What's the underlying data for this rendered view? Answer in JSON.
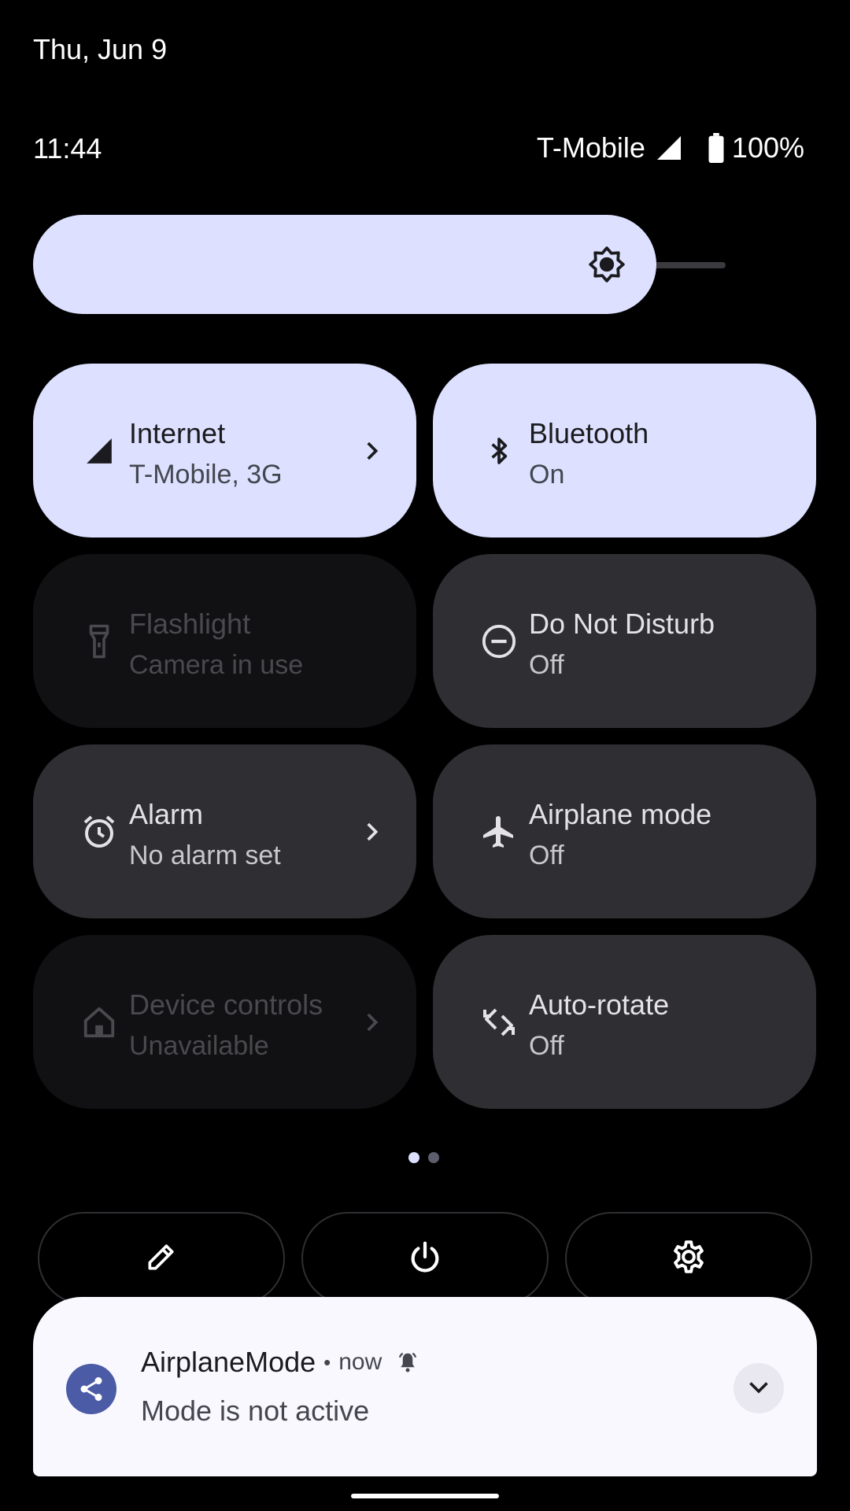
{
  "status": {
    "date": "Thu, Jun 9",
    "time": "11:44",
    "carrier": "T-Mobile",
    "battery": "100%",
    "signal_icon": "signal-full-icon",
    "battery_icon": "battery-full-icon"
  },
  "brightness": {
    "level": 0.86,
    "icon": "brightness-icon"
  },
  "tiles": [
    {
      "label": "Internet",
      "sub": "T-Mobile, 3G",
      "state": "active",
      "icon": "signal-icon",
      "chevron": true
    },
    {
      "label": "Bluetooth",
      "sub": "On",
      "state": "active",
      "icon": "bluetooth-icon",
      "chevron": false
    },
    {
      "label": "Flashlight",
      "sub": "Camera in use",
      "state": "unavailable",
      "icon": "flashlight-icon",
      "chevron": false
    },
    {
      "label": "Do Not Disturb",
      "sub": "Off",
      "state": "inactive",
      "icon": "do-not-disturb-icon",
      "chevron": false
    },
    {
      "label": "Alarm",
      "sub": "No alarm set",
      "state": "inactive",
      "icon": "alarm-icon",
      "chevron": true
    },
    {
      "label": "Airplane mode",
      "sub": "Off",
      "state": "inactive",
      "icon": "airplane-icon",
      "chevron": false
    },
    {
      "label": "Device controls",
      "sub": "Unavailable",
      "state": "unavailable",
      "icon": "home-icon",
      "chevron": true
    },
    {
      "label": "Auto-rotate",
      "sub": "Off",
      "state": "inactive",
      "icon": "auto-rotate-icon",
      "chevron": false
    }
  ],
  "pager": {
    "pages": 2,
    "current": 1
  },
  "quick_buttons": [
    {
      "name": "edit-button",
      "icon": "pencil-icon"
    },
    {
      "name": "power-button",
      "icon": "power-icon"
    },
    {
      "name": "settings-button",
      "icon": "gear-icon"
    }
  ],
  "notification": {
    "app_name": "AirplaneMode",
    "separator": "•",
    "time": "now",
    "text": "Mode is not active",
    "icon": "share-icon",
    "alert_icon": "bell-icon",
    "expand_icon": "chevron-down-icon"
  },
  "colors": {
    "active_tile": "#dde1ff",
    "inactive_tile": "#2f2f33",
    "unavailable_tile": "#111113",
    "accent_avatar": "#4b5ba5"
  }
}
